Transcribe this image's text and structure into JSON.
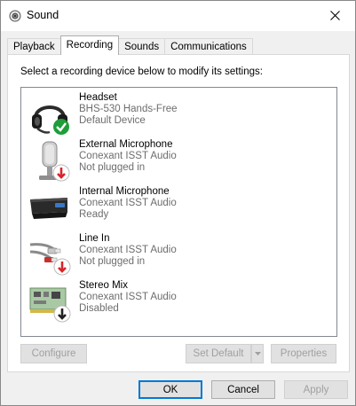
{
  "window": {
    "title": "Sound"
  },
  "tabs": [
    {
      "label": "Playback",
      "active": false
    },
    {
      "label": "Recording",
      "active": true
    },
    {
      "label": "Sounds",
      "active": false
    },
    {
      "label": "Communications",
      "active": false
    }
  ],
  "recording": {
    "instruction": "Select a recording device below to modify its settings:",
    "devices": [
      {
        "name": "Headset",
        "line1": "BHS-530 Hands-Free",
        "line2": "Default Device",
        "icon": "headset-icon",
        "badge": "default-check-badge"
      },
      {
        "name": "External Microphone",
        "line1": "Conexant ISST Audio",
        "line2": "Not plugged in",
        "icon": "external-microphone-icon",
        "badge": "unplugged-arrow-badge"
      },
      {
        "name": "Internal Microphone",
        "line1": "Conexant ISST Audio",
        "line2": "Ready",
        "icon": "internal-microphone-icon",
        "badge": ""
      },
      {
        "name": "Line In",
        "line1": "Conexant ISST Audio",
        "line2": "Not plugged in",
        "icon": "line-in-cable-icon",
        "badge": "unplugged-arrow-badge"
      },
      {
        "name": "Stereo Mix",
        "line1": "Conexant ISST Audio",
        "line2": "Disabled",
        "icon": "sound-card-icon",
        "badge": "disabled-arrow-badge"
      }
    ],
    "configure_label": "Configure",
    "set_default_label": "Set Default",
    "properties_label": "Properties"
  },
  "footer": {
    "ok_label": "OK",
    "cancel_label": "Cancel",
    "apply_label": "Apply"
  },
  "colors": {
    "accent": "#0078d7",
    "check_green": "#1e9d3a",
    "unplugged_red": "#d8242a",
    "disabled_black": "#222222"
  }
}
